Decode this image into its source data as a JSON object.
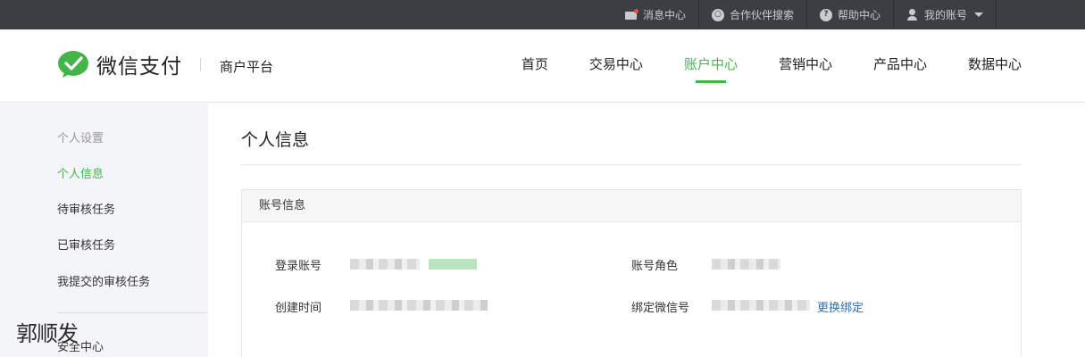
{
  "topbar": {
    "items": [
      {
        "label": "消息中心",
        "icon": "mail-icon"
      },
      {
        "label": "合作伙伴搜索",
        "icon": "search-icon"
      },
      {
        "label": "帮助中心",
        "icon": "help-icon"
      },
      {
        "label": "我的账号",
        "icon": "user-icon"
      }
    ]
  },
  "header": {
    "logo_text": "微信支付",
    "platform": "商户平台",
    "nav": [
      "首页",
      "交易中心",
      "账户中心",
      "营销中心",
      "产品中心",
      "数据中心"
    ],
    "active_nav": "账户中心",
    "accent": "#44b549"
  },
  "sidebar": {
    "group_title": "个人设置",
    "items": [
      "个人信息",
      "待审核任务",
      "已审核任务",
      "我提交的审核任务"
    ],
    "active": "个人信息",
    "security": "安全中心"
  },
  "watermark": "郭顺发",
  "main": {
    "title": "个人信息",
    "panel_title": "账号信息",
    "login_account_label": "登录账号",
    "account_role_label": "账号角色",
    "create_time_label": "创建时间",
    "bound_wechat_label": "绑定微信号",
    "change_binding_link": "更换绑定"
  }
}
